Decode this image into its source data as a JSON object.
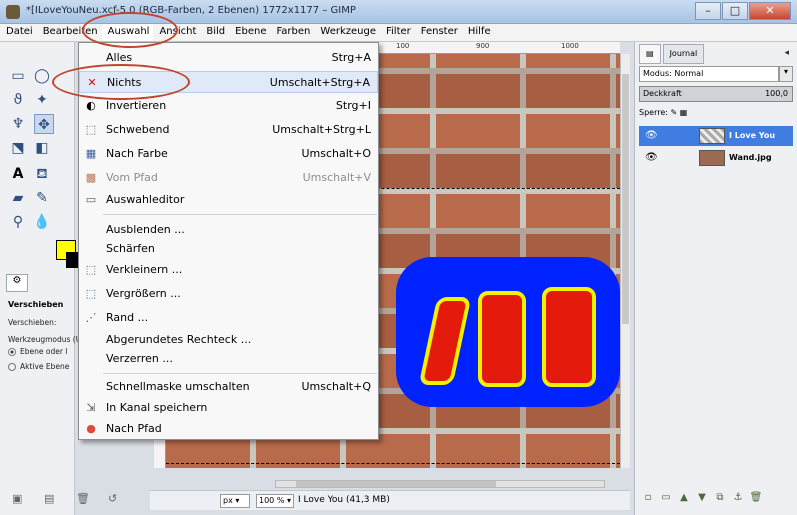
{
  "window": {
    "title": "*[ILoveYouNeu.xcf-5.0 (RGB-Farben, 2 Ebenen) 1772x1177 – GIMP",
    "minimize": "–",
    "maximize": "□",
    "close": "✕"
  },
  "menubar": {
    "items": [
      "Datei",
      "Bearbeiten",
      "Auswahl",
      "Ansicht",
      "Bild",
      "Ebene",
      "Farben",
      "Werkzeuge",
      "Filter",
      "Fenster",
      "Hilfe"
    ],
    "open_menu": "Auswahl"
  },
  "auswahl_menu": {
    "items": [
      {
        "label": "Alles",
        "shortcut": "Strg+A",
        "icon": "blank-icon"
      },
      {
        "label": "Nichts",
        "shortcut": "Umschalt+Strg+A",
        "icon": "cross-icon",
        "highlighted": true
      },
      {
        "label": "Invertieren",
        "shortcut": "Strg+I",
        "icon": "invert-icon"
      },
      {
        "label": "Schwebend",
        "shortcut": "Umschalt+Strg+L",
        "icon": "floating-icon"
      },
      {
        "label": "Nach Farbe",
        "shortcut": "Umschalt+O",
        "icon": "color-select-icon"
      },
      {
        "label": "Vom Pfad",
        "shortcut": "Umschalt+V",
        "icon": "path-icon",
        "disabled": true
      },
      {
        "label": "Auswahleditor",
        "shortcut": "",
        "icon": "selection-editor-icon"
      },
      {
        "label": "Ausblenden ...",
        "shortcut": "",
        "icon": "blank-icon"
      },
      {
        "label": "Schärfen",
        "shortcut": "",
        "icon": "blank-icon"
      },
      {
        "label": "Verkleinern ...",
        "shortcut": "",
        "icon": "shrink-icon"
      },
      {
        "label": "Vergrößern ...",
        "shortcut": "",
        "icon": "grow-icon"
      },
      {
        "label": "Rand ...",
        "shortcut": "",
        "icon": "border-icon"
      },
      {
        "label": "Abgerundetes Rechteck ...",
        "shortcut": "",
        "icon": "blank-icon"
      },
      {
        "label": "Verzerren ...",
        "shortcut": "",
        "icon": "blank-icon"
      },
      {
        "label": "Schnellmaske umschalten",
        "shortcut": "Umschalt+Q",
        "icon": "blank-icon"
      },
      {
        "label": "In Kanal speichern",
        "shortcut": "",
        "icon": "save-channel-icon"
      },
      {
        "label": "Nach Pfad",
        "shortcut": "",
        "icon": "to-path-icon"
      }
    ]
  },
  "ruler": {
    "labels": [
      "100",
      "900",
      "1000"
    ]
  },
  "tool_options": {
    "title": "Verschieben",
    "move_label": "Verschieben:",
    "mode_label": "Werkzeugmodus (U",
    "option1": "Ebene oder l",
    "option2": "Aktive Ebene"
  },
  "statusbar": {
    "unit": "px",
    "zoom": "100 %",
    "text": "I Love You (41,3 MB)"
  },
  "layers_dock": {
    "tab_journal": "Journal",
    "mode_label": "Modus: Normal",
    "opacity_label": "Deckkraft",
    "opacity_value": "100,0",
    "lock_label": "Sperre:",
    "layers": [
      {
        "name": "I Love You",
        "selected": true
      },
      {
        "name": "Wand.jpg",
        "selected": false
      }
    ]
  },
  "colors": {
    "foreground": "#ffff00",
    "background": "#000000",
    "annotation": "#c0442e",
    "selected_layer": "#3f7ee0"
  }
}
